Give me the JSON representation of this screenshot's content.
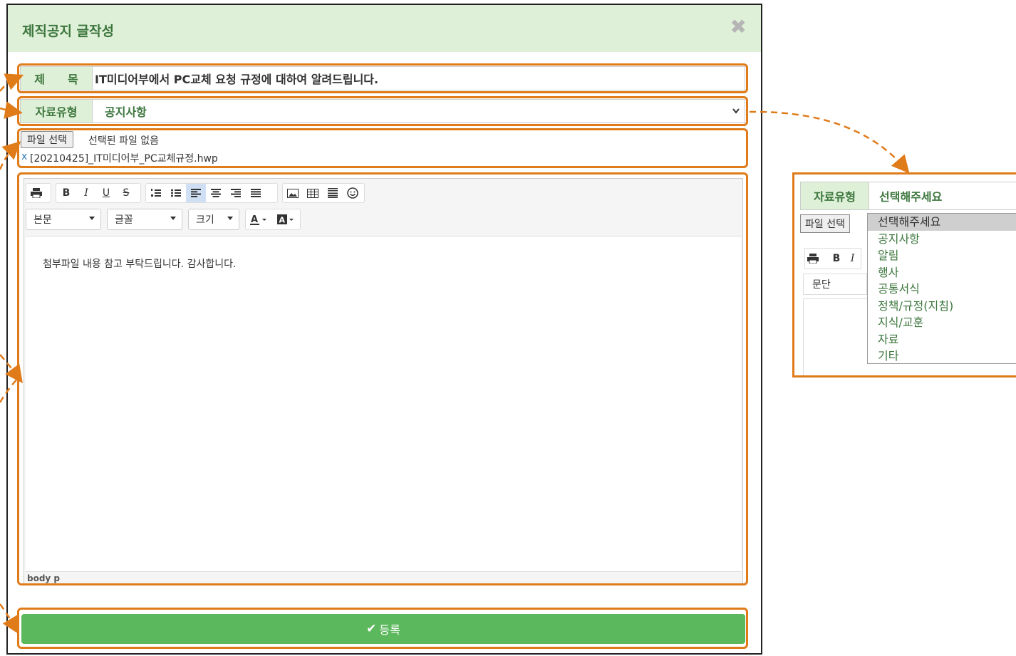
{
  "modal": {
    "title": "제직공지 글작성",
    "close_symbol": "✖",
    "title_label": "제　　목",
    "title_value": "IT미디어부에서 PC교체 요청 규정에 대하여 알려드립니다.",
    "type_label": "자료유형",
    "type_value": "공지사항",
    "file_button": "파일 선택",
    "file_none": "선택된 파일 없음",
    "file_remove": "x",
    "file_name": "[20210425]_IT미디어부_PC교체규정.hwp",
    "editor": {
      "paragraph_select": "본문",
      "font_select": "글꼴",
      "size_select": "크기",
      "content": "첨부파일 내용 참고 부탁드립니다. 감사합니다.",
      "status": "body  p"
    },
    "submit_label": "등록"
  },
  "zoom": {
    "type_label": "자료유형",
    "type_value": "선택해주세요",
    "file_button": "파일 선택",
    "paragraph_select": "문단",
    "options": [
      "선택해주세요",
      "공지사항",
      "알림",
      "행사",
      "공통서식",
      "정책/규정(지침)",
      "지식/교훈",
      "자료",
      "기타"
    ]
  },
  "colors": {
    "header_bg": "#dff0d8",
    "label_text": "#3c763d",
    "highlight": "#e07b1a",
    "submit_bg": "#5cb85c"
  }
}
